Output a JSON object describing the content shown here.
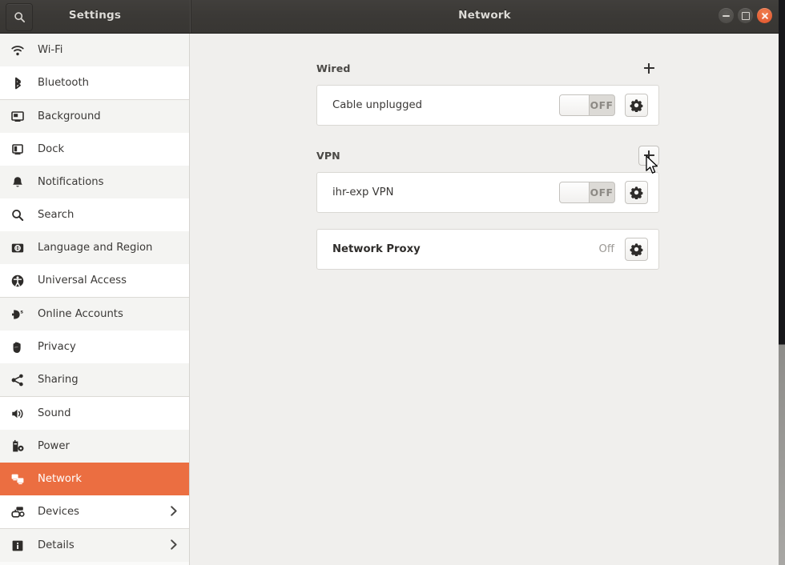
{
  "window": {
    "left_title": "Settings",
    "right_title": "Network",
    "search_icon": "search-icon",
    "controls": {
      "minimize": "minimize-button",
      "maximize": "maximize-button",
      "close": "close-button"
    }
  },
  "sidebar": {
    "items": [
      {
        "label": "Wi-Fi",
        "icon": "wifi-icon",
        "selected": false,
        "chevron": false,
        "shade": "alt",
        "group_end": false
      },
      {
        "label": "Bluetooth",
        "icon": "bluetooth-icon",
        "selected": false,
        "chevron": false,
        "shade": "plain",
        "group_end": true
      },
      {
        "label": "Background",
        "icon": "background-icon",
        "selected": false,
        "chevron": false,
        "shade": "alt",
        "group_end": false
      },
      {
        "label": "Dock",
        "icon": "dock-icon",
        "selected": false,
        "chevron": false,
        "shade": "plain",
        "group_end": false
      },
      {
        "label": "Notifications",
        "icon": "notifications-icon",
        "selected": false,
        "chevron": false,
        "shade": "alt",
        "group_end": false
      },
      {
        "label": "Search",
        "icon": "search-icon",
        "selected": false,
        "chevron": false,
        "shade": "plain",
        "group_end": false
      },
      {
        "label": "Language and Region",
        "icon": "language-icon",
        "selected": false,
        "chevron": false,
        "shade": "alt",
        "group_end": false
      },
      {
        "label": "Universal Access",
        "icon": "universal-access-icon",
        "selected": false,
        "chevron": false,
        "shade": "plain",
        "group_end": true
      },
      {
        "label": "Online Accounts",
        "icon": "online-accounts-icon",
        "selected": false,
        "chevron": false,
        "shade": "alt",
        "group_end": false
      },
      {
        "label": "Privacy",
        "icon": "privacy-icon",
        "selected": false,
        "chevron": false,
        "shade": "plain",
        "group_end": false
      },
      {
        "label": "Sharing",
        "icon": "sharing-icon",
        "selected": false,
        "chevron": false,
        "shade": "alt",
        "group_end": true
      },
      {
        "label": "Sound",
        "icon": "sound-icon",
        "selected": false,
        "chevron": false,
        "shade": "plain",
        "group_end": false
      },
      {
        "label": "Power",
        "icon": "power-icon",
        "selected": false,
        "chevron": false,
        "shade": "alt",
        "group_end": false
      },
      {
        "label": "Network",
        "icon": "network-icon",
        "selected": true,
        "chevron": false,
        "shade": "sel",
        "group_end": false
      },
      {
        "label": "Devices",
        "icon": "devices-icon",
        "selected": false,
        "chevron": true,
        "shade": "plain",
        "group_end": true
      },
      {
        "label": "Details",
        "icon": "details-icon",
        "selected": false,
        "chevron": true,
        "shade": "alt",
        "group_end": false
      }
    ]
  },
  "main": {
    "sections": [
      {
        "title": "Wired",
        "add_button": "add-wired-connection-button",
        "add_hover": false,
        "rows": [
          {
            "label": "Cable unplugged",
            "bold": false,
            "toggle": {
              "state": "OFF",
              "on": false
            },
            "gear": "wired-settings-button"
          }
        ]
      },
      {
        "title": "VPN",
        "add_button": "add-vpn-button",
        "add_hover": true,
        "rows": [
          {
            "label": "ihr-exp VPN",
            "bold": false,
            "toggle": {
              "state": "OFF",
              "on": false
            },
            "gear": "vpn-settings-button"
          }
        ]
      }
    ],
    "proxy": {
      "label": "Network Proxy",
      "status": "Off",
      "gear": "proxy-settings-button"
    }
  },
  "colors": {
    "accent": "#eb6e41",
    "titlebar": "#3b3936",
    "content_bg": "#f0efed",
    "card_bg": "#ffffff"
  }
}
